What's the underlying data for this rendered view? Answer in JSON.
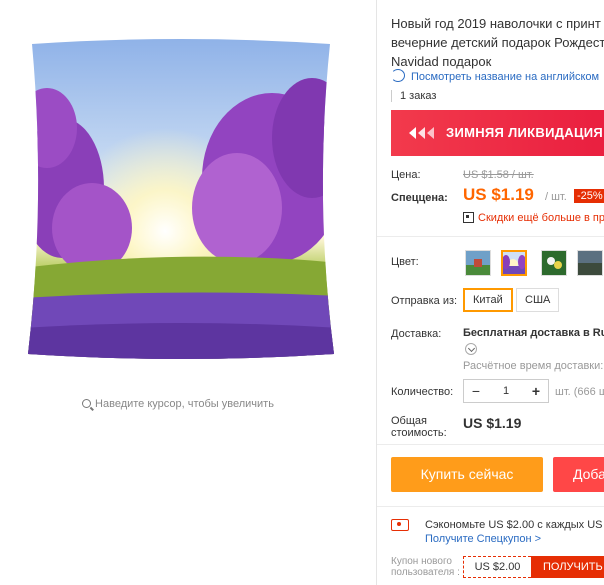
{
  "gallery": {
    "zoom_hint": "Наведите курсор, чтобы увеличить"
  },
  "product": {
    "title_line1": "Новый год 2019 наволочки с принт",
    "title_line2": "вечерние детский подарок Рождест",
    "title_line3": "Navidad подарок",
    "translate_link": "Посмотреть название на английском",
    "orders": "1 заказ"
  },
  "promo": {
    "text": "ЗИМНЯЯ ЛИКВИДАЦИЯ"
  },
  "price": {
    "label": "Цена:",
    "old": "US $1.58 / шт.",
    "sale_label": "Спеццена:",
    "sale": "US $1.19",
    "per_unit": "/ шт.",
    "discount": "-25%",
    "app_discount": "Скидки ещё больше в при"
  },
  "options": {
    "color_label": "Цвет:",
    "ship_from_label": "Отправка из:",
    "ship_options": [
      "Китай",
      "США"
    ],
    "selected_ship": "Китай"
  },
  "delivery": {
    "label": "Доставка:",
    "value": "Бесплатная доставка в Russ",
    "time": "Расчётное время доставки: 3"
  },
  "quantity": {
    "label": "Количество:",
    "value": "1",
    "minus": "−",
    "plus": "+",
    "stock": "шт. (666 ш."
  },
  "total": {
    "label": "Общая стоимость:",
    "value": "US $1.19"
  },
  "actions": {
    "buy_now": "Купить сейчас",
    "add_to_cart": "Доба"
  },
  "coupon": {
    "save_text": "Сэкономьте US $2.00 с каждых US $1",
    "get_link": "Получите Спецкупон >",
    "new_user_label": "Купон нового пользователя :",
    "amount": "US $2.00",
    "get_button": "ПОЛУЧИТЬ"
  },
  "colors": {
    "accent_orange": "#ff9c1a",
    "price_orange": "#ff6600",
    "red": "#e62e04",
    "link_blue": "#2a6bc2",
    "promo_red": "#f23a4c"
  }
}
